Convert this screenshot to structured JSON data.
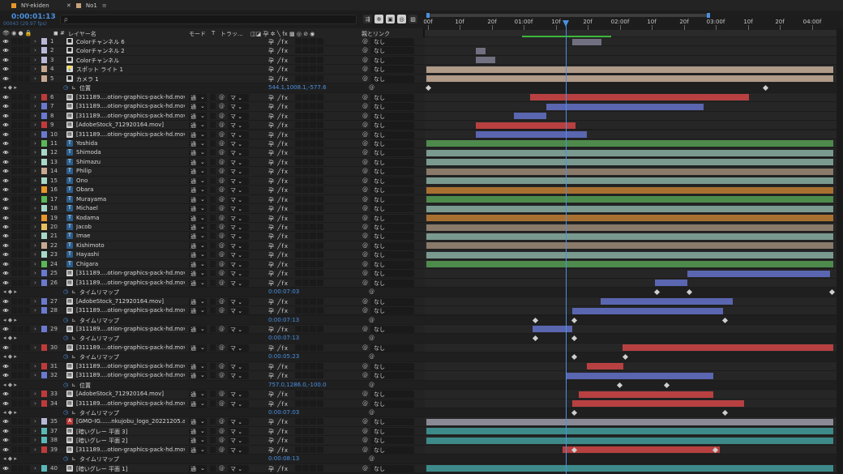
{
  "tabs": [
    {
      "label": "NY-ekiden",
      "color": "#e8962a",
      "active": false
    },
    {
      "label": "No1",
      "color": "#c8a27a",
      "active": true
    }
  ],
  "timecode": "0:00:01:13",
  "frames": "00043 (29.97 fps)",
  "search_placeholder": "ρ",
  "ruler": {
    "ticks": [
      "00f",
      "10f",
      "20f",
      "01:00f",
      "10f",
      "20f",
      "02:00f",
      "10f",
      "20f",
      "03:00f",
      "10f",
      "20f",
      "04:00f"
    ]
  },
  "headers": {
    "layer_name": "レイヤー名",
    "mode": "モード",
    "t": "T",
    "track": "トラッ...",
    "parent": "親とリンク"
  },
  "rows": [
    {
      "kind": "layer",
      "num": "1",
      "name": "Colorチャンネル 6",
      "color": "#b8b8d8",
      "type": "solid",
      "mode": "",
      "track": "",
      "parent": "なし",
      "bar": {
        "color": "#707080"
      }
    },
    {
      "kind": "layer",
      "num": "2",
      "name": "Colorチャンネル 2",
      "color": "#b8b8d8",
      "type": "solid",
      "mode": "",
      "track": "",
      "parent": "なし",
      "bar": {
        "color": "#707080"
      }
    },
    {
      "kind": "layer",
      "num": "3",
      "name": "Colorチャンネル",
      "color": "#b8b8d8",
      "type": "solid",
      "mode": "",
      "track": "",
      "parent": "なし",
      "bar": {
        "color": "#707080"
      }
    },
    {
      "kind": "layer",
      "num": "4",
      "name": "スポット ライト 1",
      "color": "#c8a890",
      "type": "light",
      "mode": "",
      "track": "",
      "parent": "なし",
      "bar": {
        "color": "#b09a88"
      }
    },
    {
      "kind": "layer",
      "num": "5",
      "name": "カメラ 1",
      "color": "#c8a890",
      "type": "camera",
      "mode": "",
      "track": "",
      "parent": "なし",
      "bar": {
        "color": "#b09a88"
      }
    },
    {
      "kind": "prop",
      "name": "位置",
      "value": "544.1,1008.1,-577.6"
    },
    {
      "kind": "layer",
      "num": "6",
      "name": "[311189....otion-graphics-pack-hd.mov]",
      "color": "#c03a3a",
      "type": "footage",
      "mode": "通",
      "track": "マ",
      "parent": "なし",
      "bar": {
        "color": "#b84040"
      }
    },
    {
      "kind": "layer",
      "num": "7",
      "name": "[311189....otion-graphics-pack-hd.mov]",
      "color": "#6a7ad0",
      "type": "footage",
      "mode": "通",
      "track": "マ",
      "parent": "なし",
      "bar": {
        "color": "#5a66b0"
      }
    },
    {
      "kind": "layer",
      "num": "8",
      "name": "[311189....otion-graphics-pack-hd.mov]",
      "color": "#6a7ad0",
      "type": "footage",
      "mode": "通",
      "track": "マ",
      "parent": "なし",
      "bar": {
        "color": "#5a66b0"
      }
    },
    {
      "kind": "layer",
      "num": "9",
      "name": "[AdobeStock_712920164.mov]",
      "color": "#c03a3a",
      "type": "footage",
      "mode": "通",
      "track": "マ",
      "parent": "なし",
      "bar": {
        "color": "#b84040"
      }
    },
    {
      "kind": "layer",
      "num": "10",
      "name": "[311189....otion-graphics-pack-hd.mov]",
      "color": "#6a7ad0",
      "type": "footage",
      "mode": "通",
      "track": "マ",
      "parent": "なし",
      "bar": {
        "color": "#5a66b0"
      }
    },
    {
      "kind": "layer",
      "num": "11",
      "name": "Yoshida",
      "color": "#5ab858",
      "type": "text",
      "mode": "通",
      "track": "マ",
      "parent": "なし",
      "bar": {
        "color": "#4e8a4c"
      }
    },
    {
      "kind": "layer",
      "num": "12",
      "name": "Shimoda",
      "color": "#a8d8c8",
      "type": "text",
      "mode": "通",
      "track": "マ",
      "parent": "なし",
      "bar": {
        "color": "#7a9a90"
      }
    },
    {
      "kind": "layer",
      "num": "13",
      "name": "Shimazu",
      "color": "#a8d8c8",
      "type": "text",
      "mode": "通",
      "track": "マ",
      "parent": "なし",
      "bar": {
        "color": "#7a9a90"
      }
    },
    {
      "kind": "layer",
      "num": "14",
      "name": "Philip",
      "color": "#c8a890",
      "type": "text",
      "mode": "通",
      "track": "マ",
      "parent": "なし",
      "bar": {
        "color": "#8a7a6a"
      }
    },
    {
      "kind": "layer",
      "num": "15",
      "name": "Ono",
      "color": "#a8d8c8",
      "type": "text",
      "mode": "通",
      "track": "マ",
      "parent": "なし",
      "bar": {
        "color": "#7a9a90"
      }
    },
    {
      "kind": "layer",
      "num": "16",
      "name": "Obara",
      "color": "#e8962a",
      "type": "text",
      "mode": "通",
      "track": "マ",
      "parent": "なし",
      "bar": {
        "color": "#a87030"
      }
    },
    {
      "kind": "layer",
      "num": "17",
      "name": "Murayama",
      "color": "#5ab858",
      "type": "text",
      "mode": "通",
      "track": "マ",
      "parent": "なし",
      "bar": {
        "color": "#4e8a4c"
      }
    },
    {
      "kind": "layer",
      "num": "18",
      "name": "Michael",
      "color": "#a8d8c8",
      "type": "text",
      "mode": "通",
      "track": "マ",
      "parent": "なし",
      "bar": {
        "color": "#7a9a90"
      }
    },
    {
      "kind": "layer",
      "num": "19",
      "name": "Kodama",
      "color": "#e8962a",
      "type": "text",
      "mode": "通",
      "track": "マ",
      "parent": "なし",
      "bar": {
        "color": "#a87030"
      }
    },
    {
      "kind": "layer",
      "num": "20",
      "name": "Jacob",
      "color": "#e8c060",
      "type": "text",
      "mode": "通",
      "track": "マ",
      "parent": "なし",
      "bar": {
        "color": "#8a7a6a"
      }
    },
    {
      "kind": "layer",
      "num": "21",
      "name": "Imae",
      "color": "#a8d8c8",
      "type": "text",
      "mode": "通",
      "track": "マ",
      "parent": "なし",
      "bar": {
        "color": "#7a9a90"
      }
    },
    {
      "kind": "layer",
      "num": "22",
      "name": "Kishimoto",
      "color": "#c8a890",
      "type": "text",
      "mode": "通",
      "track": "マ",
      "parent": "なし",
      "bar": {
        "color": "#8a7a6a"
      }
    },
    {
      "kind": "layer",
      "num": "23",
      "name": "Hayashi",
      "color": "#a8d8c8",
      "type": "text",
      "mode": "通",
      "track": "マ",
      "parent": "なし",
      "bar": {
        "color": "#7a9a90"
      }
    },
    {
      "kind": "layer",
      "num": "24",
      "name": "Chigara",
      "color": "#5ab858",
      "type": "text",
      "mode": "通",
      "track": "マ",
      "parent": "なし",
      "bar": {
        "color": "#4e8a4c"
      }
    },
    {
      "kind": "layer",
      "num": "25",
      "name": "[311189....otion-graphics-pack-hd.mov]",
      "color": "#6a7ad0",
      "type": "footage",
      "mode": "通",
      "track": "マ",
      "parent": "なし",
      "bar": {
        "color": "#5a66b0"
      }
    },
    {
      "kind": "layer",
      "num": "26",
      "name": "[311189....otion-graphics-pack-hd.mov]",
      "color": "#6a7ad0",
      "type": "footage",
      "mode": "通",
      "track": "マ",
      "parent": "なし",
      "bar": {
        "color": "#5a66b0"
      }
    },
    {
      "kind": "prop",
      "name": "タイムリマップ",
      "value": "0:00:07:03"
    },
    {
      "kind": "layer",
      "num": "27",
      "name": "[AdobeStock_712920164.mov]",
      "color": "#6a7ad0",
      "type": "footage",
      "mode": "通",
      "track": "マ",
      "parent": "なし",
      "bar": {
        "color": "#5a66b0"
      }
    },
    {
      "kind": "layer",
      "num": "28",
      "name": "[311189....otion-graphics-pack-hd.mov]",
      "color": "#6a7ad0",
      "type": "footage",
      "mode": "通",
      "track": "マ",
      "parent": "なし",
      "bar": {
        "color": "#5a66b0"
      }
    },
    {
      "kind": "prop",
      "name": "タイムリマップ",
      "value": "0:00:07:13"
    },
    {
      "kind": "layer",
      "num": "29",
      "name": "[311189....otion-graphics-pack-hd.mov]",
      "color": "#6a7ad0",
      "type": "footage",
      "mode": "通",
      "track": "マ",
      "parent": "なし",
      "bar": {
        "color": "#5a66b0"
      }
    },
    {
      "kind": "prop",
      "name": "タイムリマップ",
      "value": "0:00:07:13"
    },
    {
      "kind": "layer",
      "num": "30",
      "name": "[311189....otion-graphics-pack-hd.mov]",
      "color": "#c03a3a",
      "type": "footage",
      "mode": "通",
      "track": "マ",
      "parent": "なし",
      "bar": {
        "color": "#b84040"
      }
    },
    {
      "kind": "prop",
      "name": "タイムリマップ",
      "value": "0:00:05:23"
    },
    {
      "kind": "layer",
      "num": "31",
      "name": "[311189....otion-graphics-pack-hd.mov]",
      "color": "#c03a3a",
      "type": "footage",
      "mode": "通",
      "track": "マ",
      "parent": "なし",
      "bar": {
        "color": "#b84040"
      }
    },
    {
      "kind": "layer",
      "num": "32",
      "name": "[311189....otion-graphics-pack-hd.mov]",
      "color": "#6a7ad0",
      "type": "footage",
      "mode": "通",
      "track": "マ",
      "parent": "なし",
      "bar": {
        "color": "#5a66b0"
      }
    },
    {
      "kind": "prop",
      "name": "位置",
      "value": "757.0,1286.0,-100.0"
    },
    {
      "kind": "layer",
      "num": "33",
      "name": "[AdobeStock_712920164.mov]",
      "color": "#c03a3a",
      "type": "footage",
      "mode": "通",
      "track": "マ",
      "parent": "なし",
      "bar": {
        "color": "#b84040"
      }
    },
    {
      "kind": "layer",
      "num": "34",
      "name": "[311189....otion-graphics-pack-hd.mov]",
      "color": "#c03a3a",
      "type": "footage",
      "mode": "通",
      "track": "マ",
      "parent": "なし",
      "bar": {
        "color": "#b84040"
      }
    },
    {
      "kind": "prop",
      "name": "タイムリマップ",
      "value": "0:00:07:03"
    },
    {
      "kind": "layer",
      "num": "35",
      "name": "[GMO-IG......nkujobu_logo_20221205.ai]",
      "color": "#b8b8d8",
      "type": "ai",
      "mode": "通",
      "track": "マ",
      "parent": "なし",
      "bar": {
        "color": "#8a8a96"
      }
    },
    {
      "kind": "layer",
      "num": "37",
      "name": "[暗いグレー 平面 3]",
      "color": "#5ab8b8",
      "type": "solid2",
      "mode": "通",
      "track": "マ",
      "parent": "なし",
      "bar": {
        "color": "#3e8a8a"
      }
    },
    {
      "kind": "layer",
      "num": "38",
      "name": "[暗いグレー 平面 2]",
      "color": "#5ab8b8",
      "type": "solid2",
      "mode": "通",
      "track": "マ",
      "parent": "なし",
      "bar": {
        "color": "#3e8a8a"
      }
    },
    {
      "kind": "layer",
      "num": "39",
      "name": "[311189....otion-graphics-pack-hd.mov]",
      "color": "#c03a3a",
      "type": "footage",
      "mode": "通",
      "track": "マ",
      "parent": "なし",
      "bar": {
        "color": "#b84040"
      }
    },
    {
      "kind": "prop",
      "name": "タイムリマップ",
      "value": "0:00:08:13"
    },
    {
      "kind": "layer",
      "num": "40",
      "name": "[暗いグレー 平面 1]",
      "color": "#5ab8b8",
      "type": "solid2",
      "mode": "通",
      "track": "マ",
      "parent": "なし",
      "bar": {
        "color": "#3e8a8a"
      }
    }
  ]
}
